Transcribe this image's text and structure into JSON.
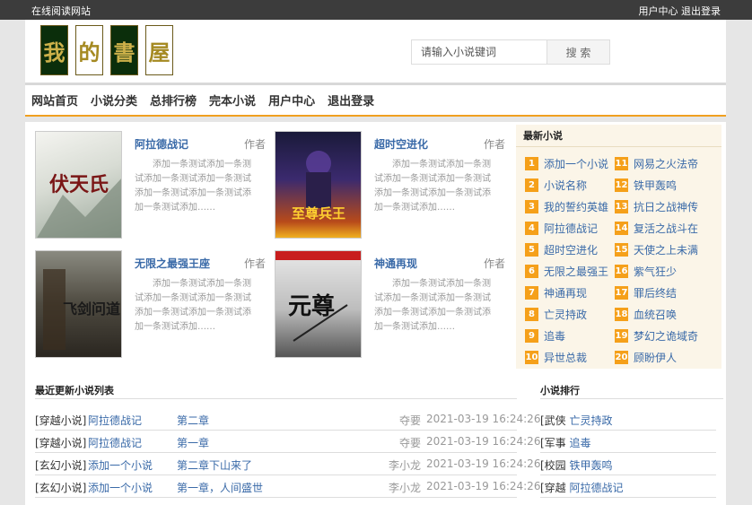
{
  "topbar": {
    "site": "在线阅读网站",
    "user_center": "用户中心",
    "logout": "退出登录"
  },
  "logo": {
    "chars": [
      "我",
      "的",
      "書",
      "屋"
    ]
  },
  "search": {
    "placeholder": "请输入小说键词",
    "button": "搜 索"
  },
  "nav": [
    "网站首页",
    "小说分类",
    "总排行榜",
    "完本小说",
    "用户中心",
    "退出登录"
  ],
  "featured": [
    {
      "title": "阿拉德战记",
      "author": "作者",
      "desc": "添加一条测试添加一条测试添加一条测试添加一条测试添加一条测试添加一条测试添加一条测试添加……",
      "cover_text": "伏天氏"
    },
    {
      "title": "超时空进化",
      "author": "作者",
      "desc": "添加一条测试添加一条测试添加一条测试添加一条测试添加一条测试添加一条测试添加一条测试添加……",
      "cover_text": "至尊兵王"
    },
    {
      "title": "无限之最强王座",
      "author": "作者",
      "desc": "添加一条测试添加一条测试添加一条测试添加一条测试添加一条测试添加一条测试添加一条测试添加……",
      "cover_text": "飞剑问道"
    },
    {
      "title": "神通再现",
      "author": "作者",
      "desc": "添加一条测试添加一条测试添加一条测试添加一条测试添加一条测试添加一条测试添加一条测试添加……",
      "cover_text": "元尊"
    }
  ],
  "latest": {
    "title": "最新小说",
    "items": [
      {
        "num": "1",
        "name": "添加一个小说"
      },
      {
        "num": "11",
        "name": "网易之火法帝"
      },
      {
        "num": "2",
        "name": "小说名称"
      },
      {
        "num": "12",
        "name": "铁甲轰鸣"
      },
      {
        "num": "3",
        "name": "我的誓约英雄"
      },
      {
        "num": "13",
        "name": "抗日之战神传"
      },
      {
        "num": "4",
        "name": "阿拉德战记"
      },
      {
        "num": "14",
        "name": "复活之战斗在"
      },
      {
        "num": "5",
        "name": "超时空进化"
      },
      {
        "num": "15",
        "name": "天使之上未满"
      },
      {
        "num": "6",
        "name": "无限之最强王"
      },
      {
        "num": "16",
        "name": "紫气狂少"
      },
      {
        "num": "7",
        "name": "神通再现"
      },
      {
        "num": "17",
        "name": "罪后终结"
      },
      {
        "num": "8",
        "name": "亡灵持政"
      },
      {
        "num": "18",
        "name": "血统召唤"
      },
      {
        "num": "9",
        "name": "追毒"
      },
      {
        "num": "19",
        "name": "梦幻之诡域奇"
      },
      {
        "num": "10",
        "name": "异世总裁"
      },
      {
        "num": "20",
        "name": "顾盼伊人"
      }
    ]
  },
  "recent": {
    "title": "最近更新小说列表",
    "rows": [
      {
        "cat": "[穿越小说]",
        "book": "阿拉德战记",
        "chapter": "第二章",
        "author": "夺要",
        "time": "2021-03-19 16:24:26"
      },
      {
        "cat": "[穿越小说]",
        "book": "阿拉德战记",
        "chapter": "第一章",
        "author": "夺要",
        "time": "2021-03-19 16:24:26"
      },
      {
        "cat": "[玄幻小说]",
        "book": "添加一个小说",
        "chapter": "第二章下山来了",
        "author": "李小龙",
        "time": "2021-03-19 16:24:26"
      },
      {
        "cat": "[玄幻小说]",
        "book": "添加一个小说",
        "chapter": "第一章，人间盛世",
        "author": "李小龙",
        "time": "2021-03-19 16:24:26"
      }
    ]
  },
  "ranking": {
    "title": "小说排行",
    "rows": [
      {
        "cat": "[武侠",
        "book": "亡灵持政"
      },
      {
        "cat": "[军事",
        "book": "追毒"
      },
      {
        "cat": "[校园",
        "book": "铁甲轰鸣"
      },
      {
        "cat": "[穿越",
        "book": "阿拉德战记"
      }
    ]
  },
  "colors": {
    "accent": "#f0a020",
    "link": "#3a6aa8",
    "topbar": "#3c3c3c",
    "badge": "#f5a01a"
  }
}
